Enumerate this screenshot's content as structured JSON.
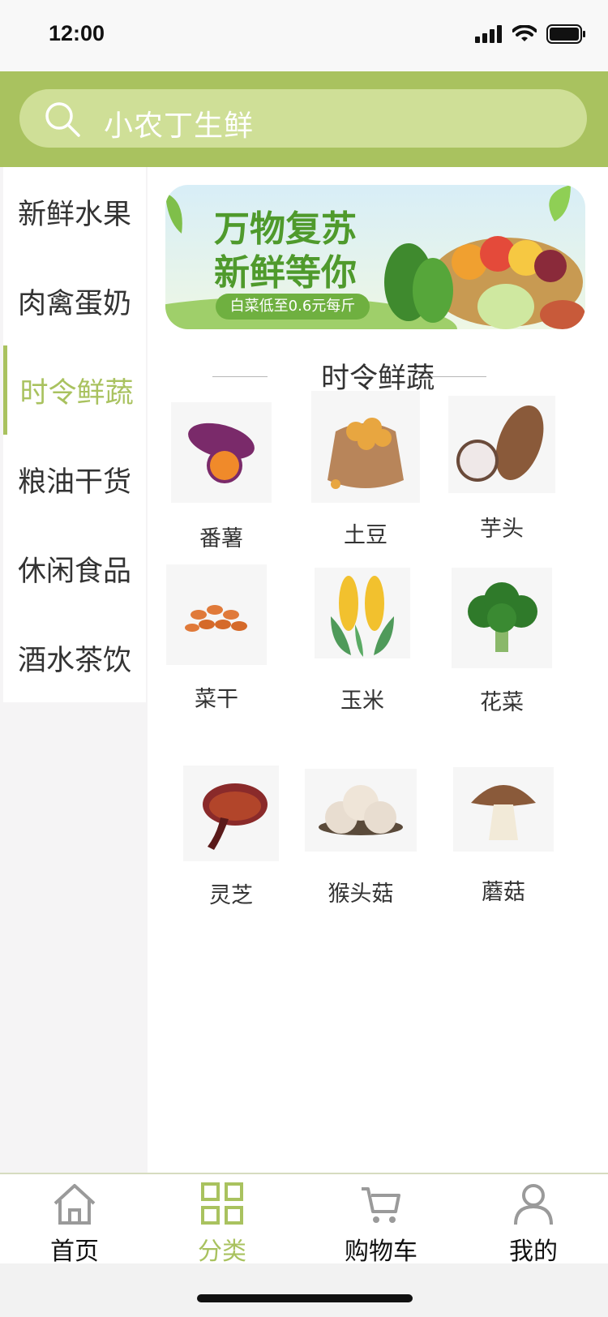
{
  "status": {
    "time": "12:00"
  },
  "search": {
    "placeholder": "小农丁生鲜"
  },
  "sidebar": {
    "items": [
      {
        "label": "新鲜水果",
        "active": false
      },
      {
        "label": "肉禽蛋奶",
        "active": false
      },
      {
        "label": "时令鲜蔬",
        "active": true
      },
      {
        "label": "粮油干货",
        "active": false
      },
      {
        "label": "休闲食品",
        "active": false
      },
      {
        "label": "酒水茶饮",
        "active": false
      }
    ]
  },
  "banner": {
    "headline_1": "万物复苏",
    "headline_2": "新鲜等你",
    "promo": "白菜低至0.6元每斤"
  },
  "section": {
    "title": "时令鲜蔬"
  },
  "products": [
    {
      "label": "番薯",
      "icon": "sweet-potato-icon"
    },
    {
      "label": "土豆",
      "icon": "potato-sack-icon"
    },
    {
      "label": "芋头",
      "icon": "taro-icon"
    },
    {
      "label": "菜干",
      "icon": "dried-vegetable-icon"
    },
    {
      "label": "玉米",
      "icon": "corn-icon"
    },
    {
      "label": "花菜",
      "icon": "broccoli-icon"
    },
    {
      "label": "灵芝",
      "icon": "lingzhi-icon"
    },
    {
      "label": "猴头菇",
      "icon": "hericium-icon"
    },
    {
      "label": "蘑菇",
      "icon": "mushroom-icon"
    }
  ],
  "tabbar": {
    "tabs": [
      {
        "label": "首页",
        "icon": "home-icon",
        "active": false
      },
      {
        "label": "分类",
        "icon": "grid-icon",
        "active": true
      },
      {
        "label": "购物车",
        "icon": "cart-icon",
        "active": false
      },
      {
        "label": "我的",
        "icon": "user-icon",
        "active": false
      }
    ]
  },
  "colors": {
    "accent": "#a9c25f",
    "search_bg": "#cfdf97",
    "text": "#333333"
  }
}
